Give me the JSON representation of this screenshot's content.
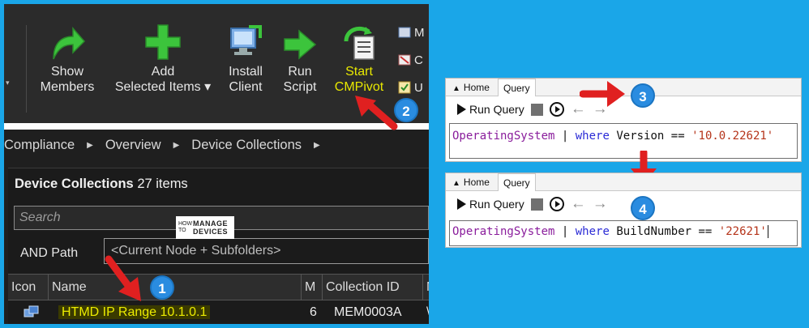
{
  "ribbon": {
    "buttons": [
      {
        "label": "Show\nMembers",
        "icon": "green-arrow-icon"
      },
      {
        "label": "Add\nSelected Items ▾",
        "icon": "green-plus-icon"
      },
      {
        "label": "Install\nClient",
        "icon": "install-client-icon"
      },
      {
        "label": "Run\nScript",
        "icon": "green-run-arrow-icon"
      },
      {
        "label": "Start\nCMPivot",
        "icon": "cmpivot-icon"
      }
    ],
    "small_items": [
      "M",
      "C",
      "U"
    ]
  },
  "breadcrumb": [
    "Compliance",
    "Overview",
    "Device Collections"
  ],
  "panel": {
    "title_bold": "Device Collections",
    "title_count": "27 items",
    "search_placeholder": "Search",
    "and_path_label": "AND Path",
    "path_value": "<Current Node + Subfolders>",
    "columns": [
      "Icon",
      "Name",
      "M",
      "Collection ID",
      "M"
    ],
    "row": {
      "name": "HTMD IP Range 10.1.0.1",
      "members": "6",
      "collection_id": "MEM0003A",
      "extra": "\\"
    }
  },
  "watermark": {
    "how_to": "HOW TO",
    "manage": "MANAGE",
    "devices": "DEVICES"
  },
  "badges": [
    "1",
    "2",
    "3",
    "4"
  ],
  "query1": {
    "tabs": [
      "Home",
      "Query"
    ],
    "run_query": "Run Query",
    "table": "OperatingSystem",
    "pipe": "|",
    "where": "where",
    "field": "Version",
    "op": "==",
    "value": "'10.0.22621'"
  },
  "query2": {
    "tabs": [
      "Home",
      "Query"
    ],
    "run_query": "Run Query",
    "table": "OperatingSystem",
    "pipe": "|",
    "where": "where",
    "field": "BuildNumber",
    "op": "==",
    "value": "'22621'"
  },
  "colors": {
    "background": "#1aa6e8",
    "badge": "#2a8ce0",
    "arrow": "#e02020",
    "highlight": "#ecec00"
  }
}
